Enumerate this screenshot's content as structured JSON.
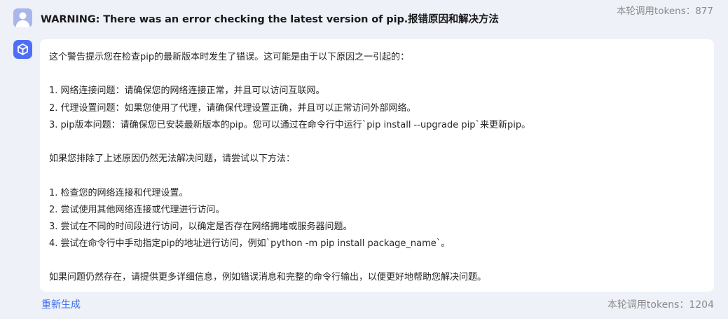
{
  "question": {
    "text": "WARNING: There was an error checking the latest version of pip.报错原因和解决方法",
    "tokens_label": "本轮调用tokens：877"
  },
  "answer": {
    "intro": "这个警告提示您在检查pip的最新版本时发生了错误。这可能是由于以下原因之一引起的：",
    "causes": [
      "1. 网络连接问题：请确保您的网络连接正常，并且可以访问互联网。",
      "2. 代理设置问题：如果您使用了代理，请确保代理设置正确，并且可以正常访问外部网络。",
      "3. pip版本问题：请确保您已安装最新版本的pip。您可以通过在命令行中运行`pip install --upgrade pip`来更新pip。"
    ],
    "transition": "如果您排除了上述原因仍然无法解决问题，请尝试以下方法：",
    "methods": [
      "1. 检查您的网络连接和代理设置。",
      "2. 尝试使用其他网络连接或代理进行访问。",
      "3. 尝试在不同的时间段进行访问，以确定是否存在网络拥堵或服务器问题。",
      "4. 尝试在命令行中手动指定pip的地址进行访问，例如`python -m pip install package_name`。"
    ],
    "closing": "如果问题仍然存在，请提供更多详细信息，例如错误消息和完整的命令行输出，以便更好地帮助您解决问题。"
  },
  "footer": {
    "regenerate_label": "重新生成",
    "tokens_label": "本轮调用tokens：1204"
  },
  "colors": {
    "page_background": "#eef1f8",
    "card_background": "#ffffff",
    "accent": "#3c6df0",
    "bot_avatar": "#4f6ef7",
    "user_avatar": "#a9b6ea",
    "muted_text": "#8c8c8c"
  },
  "icons": {
    "user_avatar": "person-icon",
    "bot_avatar": "cube-icon"
  }
}
